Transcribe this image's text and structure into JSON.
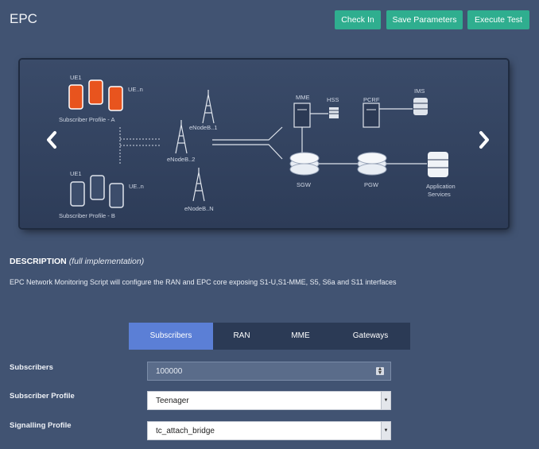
{
  "header": {
    "title": "EPC",
    "buttons": {
      "check_in": "Check In",
      "save": "Save Parameters",
      "execute": "Execute Test"
    }
  },
  "diagram": {
    "ue_top": "UE1",
    "ue_top_n": "UE..n",
    "profile_a": "Subscriber Profile - A",
    "ue_bottom": "UE1",
    "ue_bottom_n": "UE..n",
    "profile_b": "Subscriber Profile - B",
    "enodeb_1": "eNodeB..1",
    "enodeb_2": "eNodeB..2",
    "enodeb_n": "eNodeB..N",
    "mme": "MME",
    "hss": "HSS",
    "pcrf": "PCRF",
    "ims": "IMS",
    "sgw": "SGW",
    "pgw": "PGW",
    "app_services_1": "Application",
    "app_services_2": "Services",
    "prev_icon": "chevron-left-icon",
    "next_icon": "chevron-right-icon"
  },
  "description": {
    "title": "DESCRIPTION",
    "subtitle": "(full implementation)",
    "text": "EPC Network Monitoring Script will configure the RAN and EPC core exposing S1-U,S1-MME, S5, S6a and S11 interfaces"
  },
  "tabs": [
    {
      "label": "Subscribers",
      "active": true
    },
    {
      "label": "RAN",
      "active": false
    },
    {
      "label": "MME",
      "active": false
    },
    {
      "label": "Gateways",
      "active": false
    }
  ],
  "form": {
    "subscribers_label": "Subscribers",
    "subscribers_value": "100000",
    "profile_label": "Subscriber Profile",
    "profile_value": "Teenager",
    "signalling_label": "Signalling Profile",
    "signalling_value": "tc_attach_bridge"
  },
  "colors": {
    "background": "#415372",
    "accent_green": "#2fae8f",
    "active_tab": "#5b7fd6",
    "phone_orange": "#e8541e"
  }
}
